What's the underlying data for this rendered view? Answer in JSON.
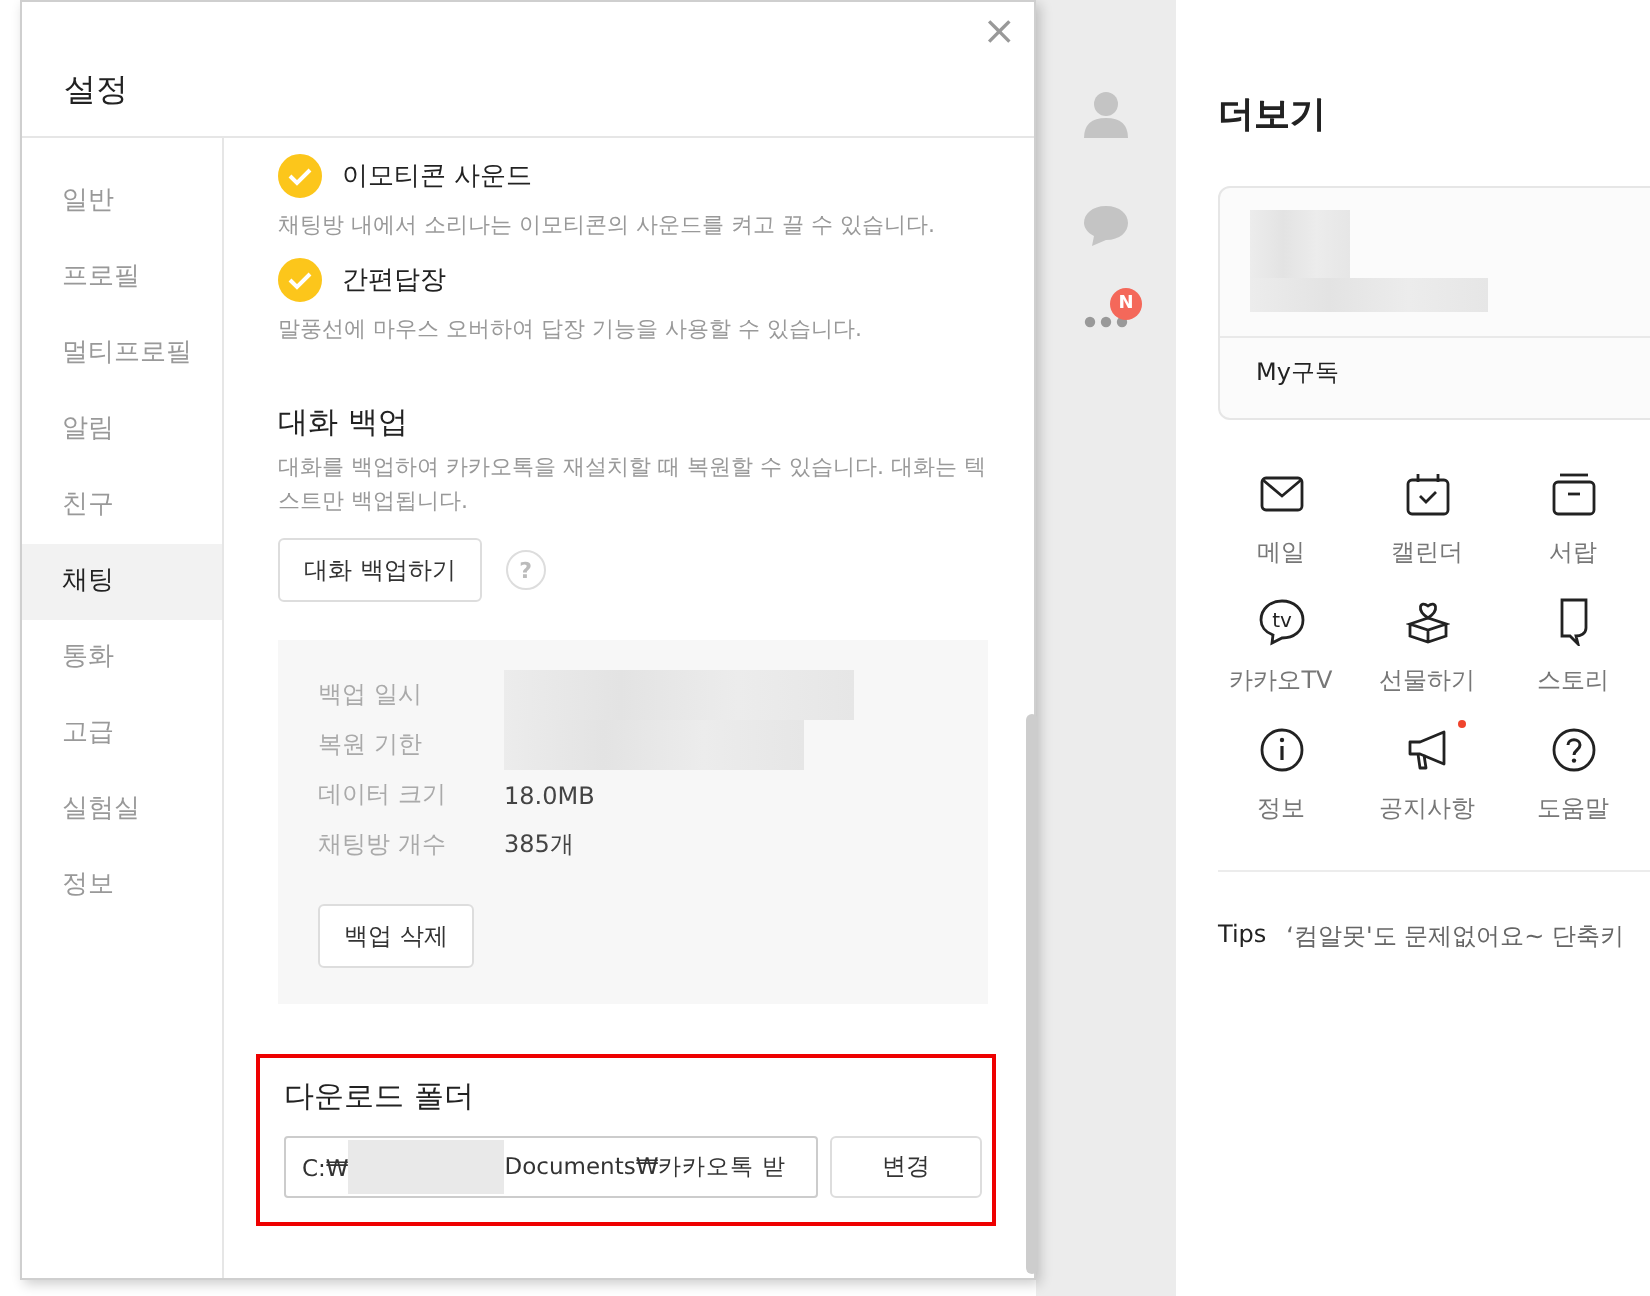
{
  "settings_dialog": {
    "title": "설정",
    "close": "×",
    "nav": [
      {
        "label": "일반",
        "selected": false
      },
      {
        "label": "프로필",
        "selected": false
      },
      {
        "label": "멀티프로필",
        "selected": false
      },
      {
        "label": "알림",
        "selected": false
      },
      {
        "label": "친구",
        "selected": false
      },
      {
        "label": "채팅",
        "selected": true
      },
      {
        "label": "통화",
        "selected": false
      },
      {
        "label": "고급",
        "selected": false
      },
      {
        "label": "실험실",
        "selected": false
      },
      {
        "label": "정보",
        "selected": false
      }
    ],
    "options": [
      {
        "label": "이모티콘 사운드",
        "checked": true,
        "description": "채팅방 내에서 소리나는 이모티콘의 사운드를 켜고 끌 수 있습니다."
      },
      {
        "label": "간편답장",
        "checked": true,
        "description": "말풍선에 마우스 오버하여 답장 기능을 사용할 수 있습니다."
      }
    ],
    "backup": {
      "title": "대화 백업",
      "description": "대화를 백업하여 카카오톡을 재설치할 때 복원할 수 있습니다. 대화는 텍스트만 백업됩니다.",
      "button": "대화 백업하기",
      "help": "?",
      "details": [
        {
          "label": "백업 일시",
          "kind": "redacted"
        },
        {
          "label": "복원 기한",
          "kind": "redacted"
        },
        {
          "label": "데이터 크기",
          "kind": "text",
          "value": "18.0MB"
        },
        {
          "label": "채팅방 개수",
          "kind": "text",
          "value": "385개"
        }
      ],
      "delete_button": "백업 삭제"
    },
    "download_folder": {
      "title": "다운로드 폴더",
      "highlighted": true,
      "path_start": "C:₩",
      "path_end": "Documents₩카카오톡 받",
      "button": "변경"
    }
  },
  "app": {
    "nav": [
      {
        "kind": "profile"
      },
      {
        "kind": "chat"
      },
      {
        "kind": "more",
        "badge": "N"
      }
    ],
    "more": {
      "title": "더보기",
      "card_link": "My구독",
      "menu": [
        {
          "label": "메일",
          "kind": "mail",
          "dot": false
        },
        {
          "label": "캘린더",
          "kind": "calendar",
          "dot": false
        },
        {
          "label": "서랍",
          "kind": "drawer",
          "dot": false
        },
        {
          "label": "카카오TV",
          "kind": "tv",
          "icon_text": "tv",
          "dot": false
        },
        {
          "label": "선물하기",
          "kind": "gift",
          "dot": false
        },
        {
          "label": "스토리",
          "kind": "story",
          "dot": false
        },
        {
          "label": "정보",
          "kind": "info",
          "dot": false
        },
        {
          "label": "공지사항",
          "kind": "notice",
          "dot": true
        },
        {
          "label": "도움말",
          "kind": "help",
          "dot": false
        }
      ],
      "tips": {
        "label": "Tips",
        "text": "‘컴알못'도 문제없어요~ 단축키"
      }
    }
  }
}
